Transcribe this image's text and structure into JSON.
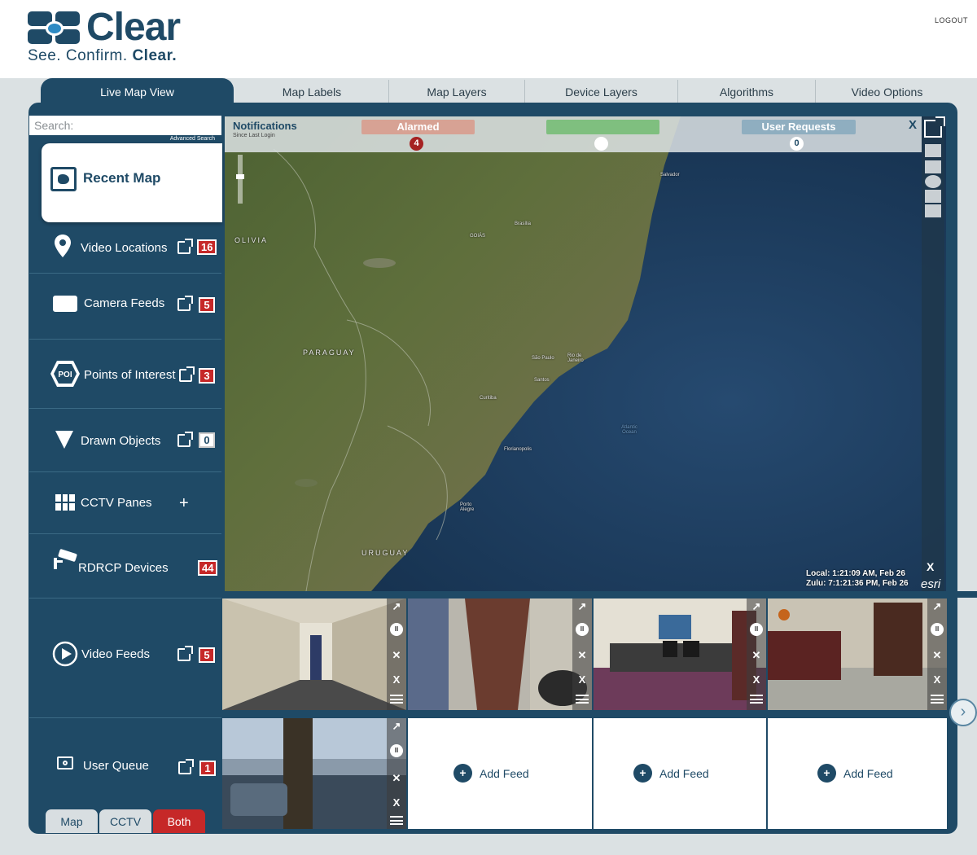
{
  "brand": {
    "name": "Clear",
    "tagline_prefix": "See. Confirm.",
    "tagline_bold": "Clear."
  },
  "header": {
    "logout": "LOGOUT"
  },
  "tabs": [
    {
      "label": "Live Map View",
      "active": true
    },
    {
      "label": "Map Labels"
    },
    {
      "label": "Map Layers"
    },
    {
      "label": "Device Layers"
    },
    {
      "label": "Algorithms"
    },
    {
      "label": "Video Options"
    }
  ],
  "sidebar": {
    "search_placeholder": "Search:",
    "advanced_search": "Advanced Search",
    "recent_map": "Recent Map",
    "items": [
      {
        "label": "Video Locations",
        "icon": "map-pin-icon",
        "count": "16"
      },
      {
        "label": "Camera Feeds",
        "icon": "camera-feed-icon",
        "count": "5"
      },
      {
        "label": "Points of Interest",
        "icon": "poi-icon",
        "icon_text": "POI",
        "count": "3"
      },
      {
        "label": "Drawn Objects",
        "icon": "triangle-icon",
        "count": "0"
      },
      {
        "label": "CCTV Panes",
        "icon": "grid-icon",
        "action": "+"
      },
      {
        "label": "RDRCP Devices",
        "icon": "cctv-camera-icon",
        "count": "44"
      },
      {
        "label": "Video Feeds",
        "icon": "play-icon",
        "count": "5"
      },
      {
        "label": "User Queue",
        "icon": "queue-icon",
        "count": "1"
      }
    ]
  },
  "notifications": {
    "title": "Notifications",
    "subtitle": "Since Last Login",
    "alarmed_label": "Alarmed",
    "alarmed_count": "4",
    "green_count": "",
    "user_requests_label": "User Requests",
    "user_requests_count": "0",
    "close": "X",
    "colors": {
      "alarmed": "#d7a294",
      "green": "#7fbf7f",
      "user_requests": "#8faec0",
      "alarmed_badge": "#a52222"
    }
  },
  "map": {
    "local_time": "Local: 1:21:09 AM, Feb 26",
    "zulu_time": "Zulu: 7:1:21:36 PM, Feb 26",
    "close": "X",
    "esri": "esri",
    "labels": {
      "bolivia": "OLIVIA",
      "paraguay": "PARAGUAY",
      "uruguay": "URUGUAY",
      "atlantic": "Atlantic Ocean",
      "salvador": "Salvador",
      "rio": "Rio de Janeiro",
      "florianopolis": "Florianopolis",
      "santos": "Santos",
      "sao_paulo": "São Paulo",
      "curitiba": "Curitiba",
      "brasilia": "Brasília",
      "goias": "GOIÁS",
      "porto_alegre": "Porto Alegre"
    }
  },
  "feeds": {
    "add_feed": "Add Feed",
    "ext_icon": "external-link-icon",
    "pause": "II",
    "mute": "✕",
    "close": "X"
  },
  "view_toggle": [
    {
      "label": "Map"
    },
    {
      "label": "CCTV"
    },
    {
      "label": "Both",
      "active": true
    }
  ],
  "colors": {
    "primary": "#1f4a66",
    "badge_red": "#c62828",
    "band": "#dbe1e3"
  }
}
